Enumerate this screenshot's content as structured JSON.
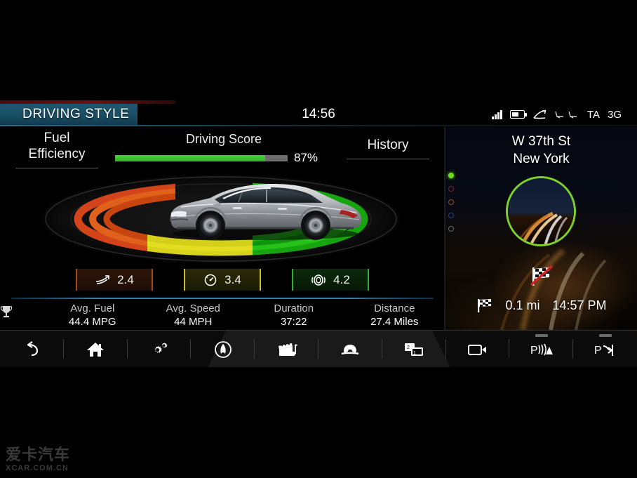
{
  "header": {
    "title": "DRIVING STYLE",
    "clock": "14:56",
    "status": {
      "signal_icon": "signal-bars-icon",
      "battery_icon": "battery-icon",
      "route_icon": "route-icon",
      "seat_icon": "seat-heating-icon",
      "traffic_label": "TA",
      "network_label": "3G"
    }
  },
  "tabs": {
    "fuel_efficiency": "Fuel\nEfficiency",
    "fuel_efficiency_line1": "Fuel",
    "fuel_efficiency_line2": "Efficiency",
    "driving_score": "Driving Score",
    "driving_score_percent": "87%",
    "driving_score_value": 87,
    "history": "History"
  },
  "badges": [
    {
      "icon": "acceleration-icon",
      "value": "2.4",
      "color": "#a8491a"
    },
    {
      "icon": "speedometer-icon",
      "value": "3.4",
      "color": "#c9c11f"
    },
    {
      "icon": "steering-wheel-icon",
      "value": "4.2",
      "color": "#2fb02f"
    }
  ],
  "stats": {
    "trophy_icon": "trophy-icon",
    "items": [
      {
        "label": "Avg. Fuel",
        "value": "44.4 MPG"
      },
      {
        "label": "Avg. Speed",
        "value": "44 MPH"
      },
      {
        "label": "Duration",
        "value": "37:22"
      },
      {
        "label": "Distance",
        "value": "27.4 Miles"
      }
    ]
  },
  "nav": {
    "street": "W 37th St",
    "city": "New York",
    "no_destination_icon": "checkered-flag-crossed-icon",
    "distance_icon": "checkered-flag-icon",
    "distance": "0.1 mi",
    "eta": "14:57 PM",
    "ring_color": "#7fd029",
    "page_dots": [
      {
        "name": "dot-green",
        "active": true,
        "color": "#6fdb1e"
      },
      {
        "name": "dot-red",
        "active": false,
        "color": "#7a2430"
      },
      {
        "name": "dot-orange",
        "active": false,
        "color": "#8a5218"
      },
      {
        "name": "dot-blue",
        "active": false,
        "color": "#2c3f84"
      },
      {
        "name": "dot-gray",
        "active": false,
        "color": "#6b6b6b"
      }
    ]
  },
  "toolbar": [
    {
      "name": "back-button",
      "icon": "back-arrow-icon"
    },
    {
      "name": "home-button",
      "icon": "home-icon"
    },
    {
      "name": "settings-button",
      "icon": "gears-icon"
    },
    {
      "name": "navigation-button",
      "icon": "navigation-arrow-icon"
    },
    {
      "name": "media-button",
      "icon": "media-clapperboard-icon"
    },
    {
      "name": "phone-button",
      "icon": "telephone-icon"
    },
    {
      "name": "dual-view-button",
      "icon": "dual-screen-icon",
      "badge_top": "2",
      "badge_bottom": "1"
    },
    {
      "name": "camera-button",
      "icon": "camera-icon"
    },
    {
      "name": "park-distance-button",
      "icon": "park-distance-icon"
    },
    {
      "name": "park-assist-button",
      "icon": "park-assist-icon"
    }
  ],
  "watermark": {
    "cn": "爱卡汽车",
    "en": "XCAR.COM.CN"
  }
}
